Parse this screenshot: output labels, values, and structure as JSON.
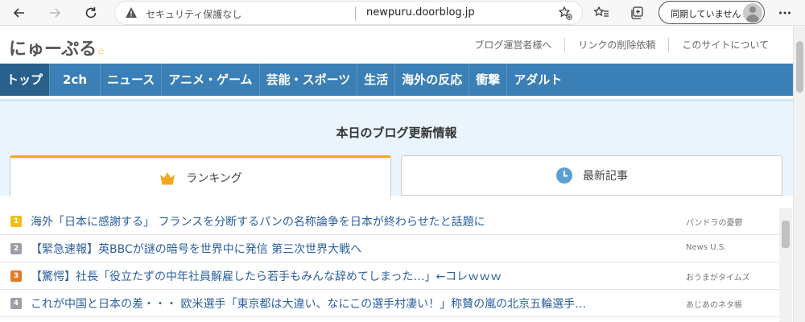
{
  "browser": {
    "security_label": "セキュリティ保護なし",
    "url": "newpuru.doorblog.jp",
    "sync_label": "同期していません"
  },
  "site": {
    "logo": "にゅーぷる",
    "top_links": [
      "ブログ運営者様へ",
      "リンクの削除依頼",
      "このサイトについて"
    ]
  },
  "nav": {
    "items": [
      "トップ",
      "2ch",
      "ニュース",
      "アニメ・ゲーム",
      "芸能・スポーツ",
      "生活",
      "海外の反応",
      "衝撃",
      "アダルト"
    ],
    "active": 0
  },
  "hero": {
    "title": "本日のブログ更新情報",
    "tabs": [
      {
        "label": "ランキング",
        "icon": "crown-icon"
      },
      {
        "label": "最新記事",
        "icon": "clock-icon"
      }
    ]
  },
  "colors": {
    "nav_bg": "#3a7fb5",
    "rank1": "#f3c01a",
    "rank2": "#9aa0a6",
    "rank3": "#e07b28",
    "rank4": "#9aa0a6"
  },
  "articles": [
    {
      "rank": "1",
      "title": "海外「日本に感謝する」 フランスを分断するパンの名称論争を日本が終わらせたと話題に",
      "site": "パンドラの憂鬱"
    },
    {
      "rank": "2",
      "title": "【緊急速報】英BBCが謎の暗号を世界中に発信 第三次世界大戦へ",
      "site": "News U.S."
    },
    {
      "rank": "3",
      "title": "【驚愕】社長「役立たずの中年社員解雇したら若手もみんな辞めてしまった…」←コレｗｗｗ",
      "site": "おうまがタイムズ"
    },
    {
      "rank": "4",
      "title": "これが中国と日本の差・・・ 欧米選手「東京都は大違い、なにこの選手村凄い！」称賛の嵐の北京五輪選手…",
      "site": "あじあのネタ帳"
    }
  ]
}
